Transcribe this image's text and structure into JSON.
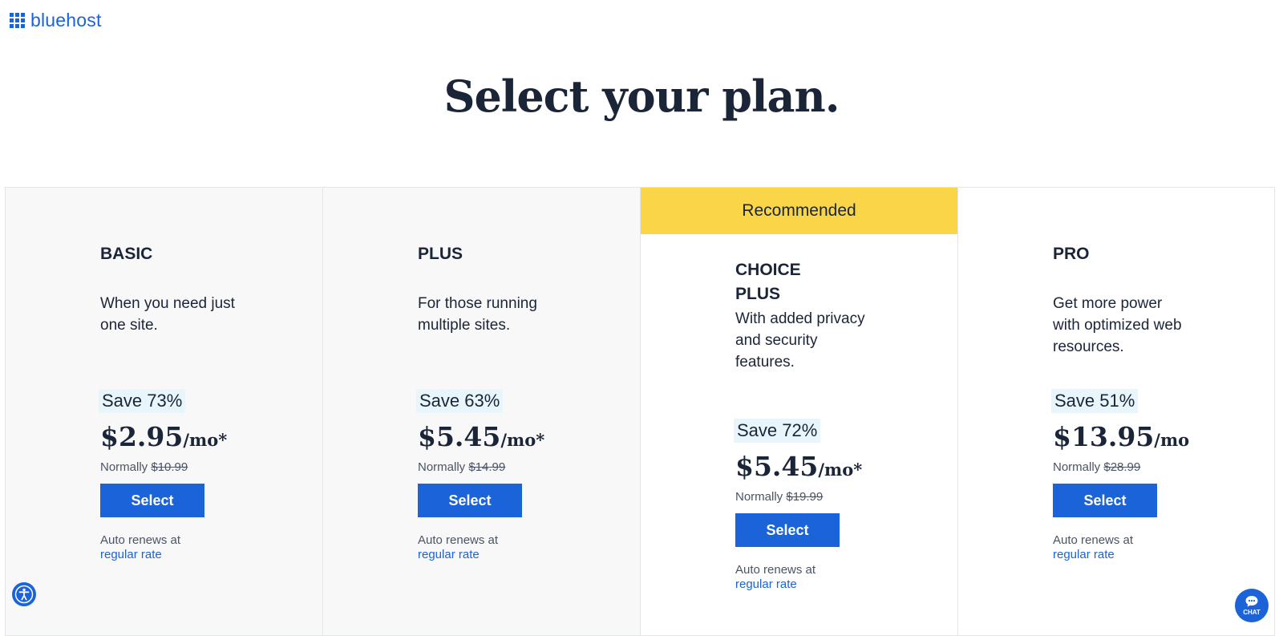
{
  "logo": {
    "text": "bluehost"
  },
  "page_title": "Select your plan.",
  "plans": [
    {
      "name": "BASIC",
      "description": "When you need just one site.",
      "save": "Save 73%",
      "price": "$2.95",
      "unit": "/mo*",
      "normally_label": "Normally",
      "normally_price": "$10.99",
      "select_label": "Select",
      "renew_text": "Auto renews at",
      "renew_link": "regular rate"
    },
    {
      "name": "PLUS",
      "description": "For those running multiple sites.",
      "save": "Save 63%",
      "price": "$5.45",
      "unit": "/mo*",
      "normally_label": "Normally",
      "normally_price": "$14.99",
      "select_label": "Select",
      "renew_text": "Auto renews at",
      "renew_link": "regular rate"
    },
    {
      "badge": "Recommended",
      "name": "CHOICE PLUS",
      "description": "With added privacy and security features.",
      "save": "Save 72%",
      "price": "$5.45",
      "unit": "/mo*",
      "normally_label": "Normally",
      "normally_price": "$19.99",
      "select_label": "Select",
      "renew_text": "Auto renews at",
      "renew_link": "regular rate"
    },
    {
      "name": "PRO",
      "description": "Get more power with optimized web resources.",
      "save": "Save 51%",
      "price": "$13.95",
      "unit": "/mo",
      "normally_label": "Normally",
      "normally_price": "$28.99",
      "select_label": "Select",
      "renew_text": "Auto renews at",
      "renew_link": "regular rate"
    }
  ],
  "chat": {
    "label": "CHAT"
  },
  "colors": {
    "brand_blue": "#1b63d8",
    "recommended_yellow": "#f9d547",
    "text_dark": "#1b2538",
    "save_badge_bg": "#e8f6fb"
  },
  "icons": {
    "logo": "grid-icon",
    "accessibility": "accessibility-icon",
    "chat": "chat-bubble-icon"
  }
}
